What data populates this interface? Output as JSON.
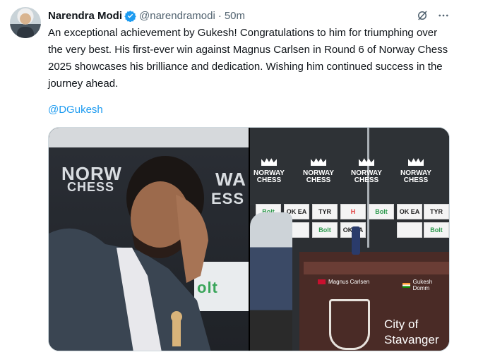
{
  "tweet": {
    "author_name": "Narendra Modi",
    "handle": "@narendramodi",
    "separator": "·",
    "time": "50m",
    "text": "An exceptional achievement by Gukesh! Congratulations to him for triumphing over the very best. His first-ever win against Magnus Carlsen in Round 6 of Norway Chess 2025 showcases his brilliance and dedication. Wishing him continued success in the journey ahead.",
    "mention": "@DGukesh"
  },
  "icons": {
    "verified": "verified-badge-icon",
    "grok": "grok-icon",
    "more": "more-icon"
  },
  "colors": {
    "link": "#1d9bf0",
    "verified": "#1d9bf0",
    "muted": "#536471"
  },
  "media": {
    "left_bg_text_1": "NORW",
    "left_bg_text_2": "CHESS",
    "left_bg_text_3": "WA",
    "left_bg_text_4": "ESS",
    "left_sponsor": "olt",
    "logos": [
      {
        "line1": "NORWAY",
        "line2": "CHESS"
      },
      {
        "line1": "NORWAY",
        "line2": "CHESS"
      },
      {
        "line1": "NORWAY",
        "line2": "CHESS"
      },
      {
        "line1": "NORWAY",
        "line2": "CHESS"
      }
    ],
    "sponsors_row1": [
      "Bolt",
      "OK EA",
      "TYR",
      "H",
      "Bolt",
      "OK EA",
      "TYR"
    ],
    "sponsors_row2": [
      "",
      "",
      "Bolt",
      "OK EA",
      "",
      "",
      "Bolt"
    ],
    "player1": "Magnus Carlsen",
    "player2": "Gukesh Domm",
    "city_line1": "City of",
    "city_line2": "Stavanger"
  }
}
